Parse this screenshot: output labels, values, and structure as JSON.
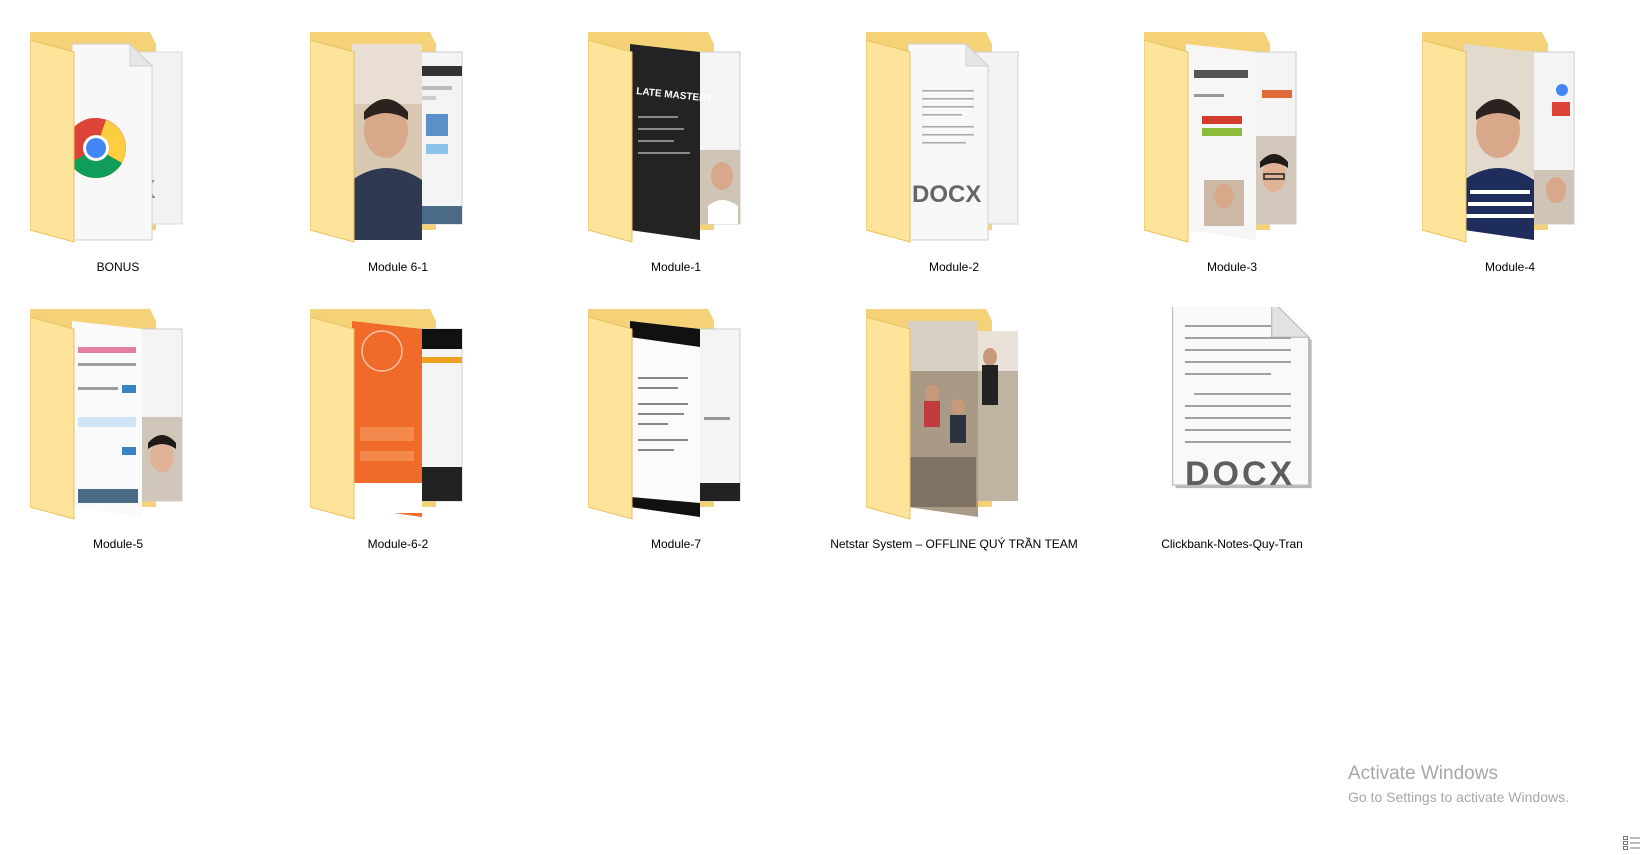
{
  "items": [
    {
      "name": "BONUS",
      "kind": "folder",
      "preview": "chrome"
    },
    {
      "name": "Module 6-1",
      "kind": "folder",
      "preview": "video-person"
    },
    {
      "name": "Module-1",
      "kind": "folder",
      "preview": "dark-slide"
    },
    {
      "name": "Module-2",
      "kind": "folder",
      "preview": "docx"
    },
    {
      "name": "Module-3",
      "kind": "folder",
      "preview": "browser-person"
    },
    {
      "name": "Module-4",
      "kind": "folder",
      "preview": "video-person"
    },
    {
      "name": "Module-5",
      "kind": "folder",
      "preview": "browser-person"
    },
    {
      "name": "Module-6-2",
      "kind": "folder",
      "preview": "orange-app"
    },
    {
      "name": "Module-7",
      "kind": "folder",
      "preview": "document-screen"
    },
    {
      "name": "Netstar System – OFFLINE QUÝ TRẦN TEAM",
      "kind": "folder",
      "preview": "photo-room"
    },
    {
      "name": "Clickbank-Notes-Quy-Tran",
      "kind": "docx-file",
      "file_badge": "DOCX"
    }
  ],
  "preview_texts": {
    "docx_badge": "DOCX",
    "slide_text": "LATE MASTERY"
  },
  "watermark": {
    "title": "Activate Windows",
    "subtitle": "Go to Settings to activate Windows."
  },
  "colors": {
    "folder_back": "#f5d277",
    "folder_front": "#fde49a",
    "folder_shadow": "#e8c25e",
    "label": "#000000",
    "watermark": "#a7a7a7"
  },
  "icons": {
    "folder": "folder-icon",
    "docx": "docx-file-icon",
    "chrome": "chrome-icon",
    "view": "details-view-icon"
  }
}
